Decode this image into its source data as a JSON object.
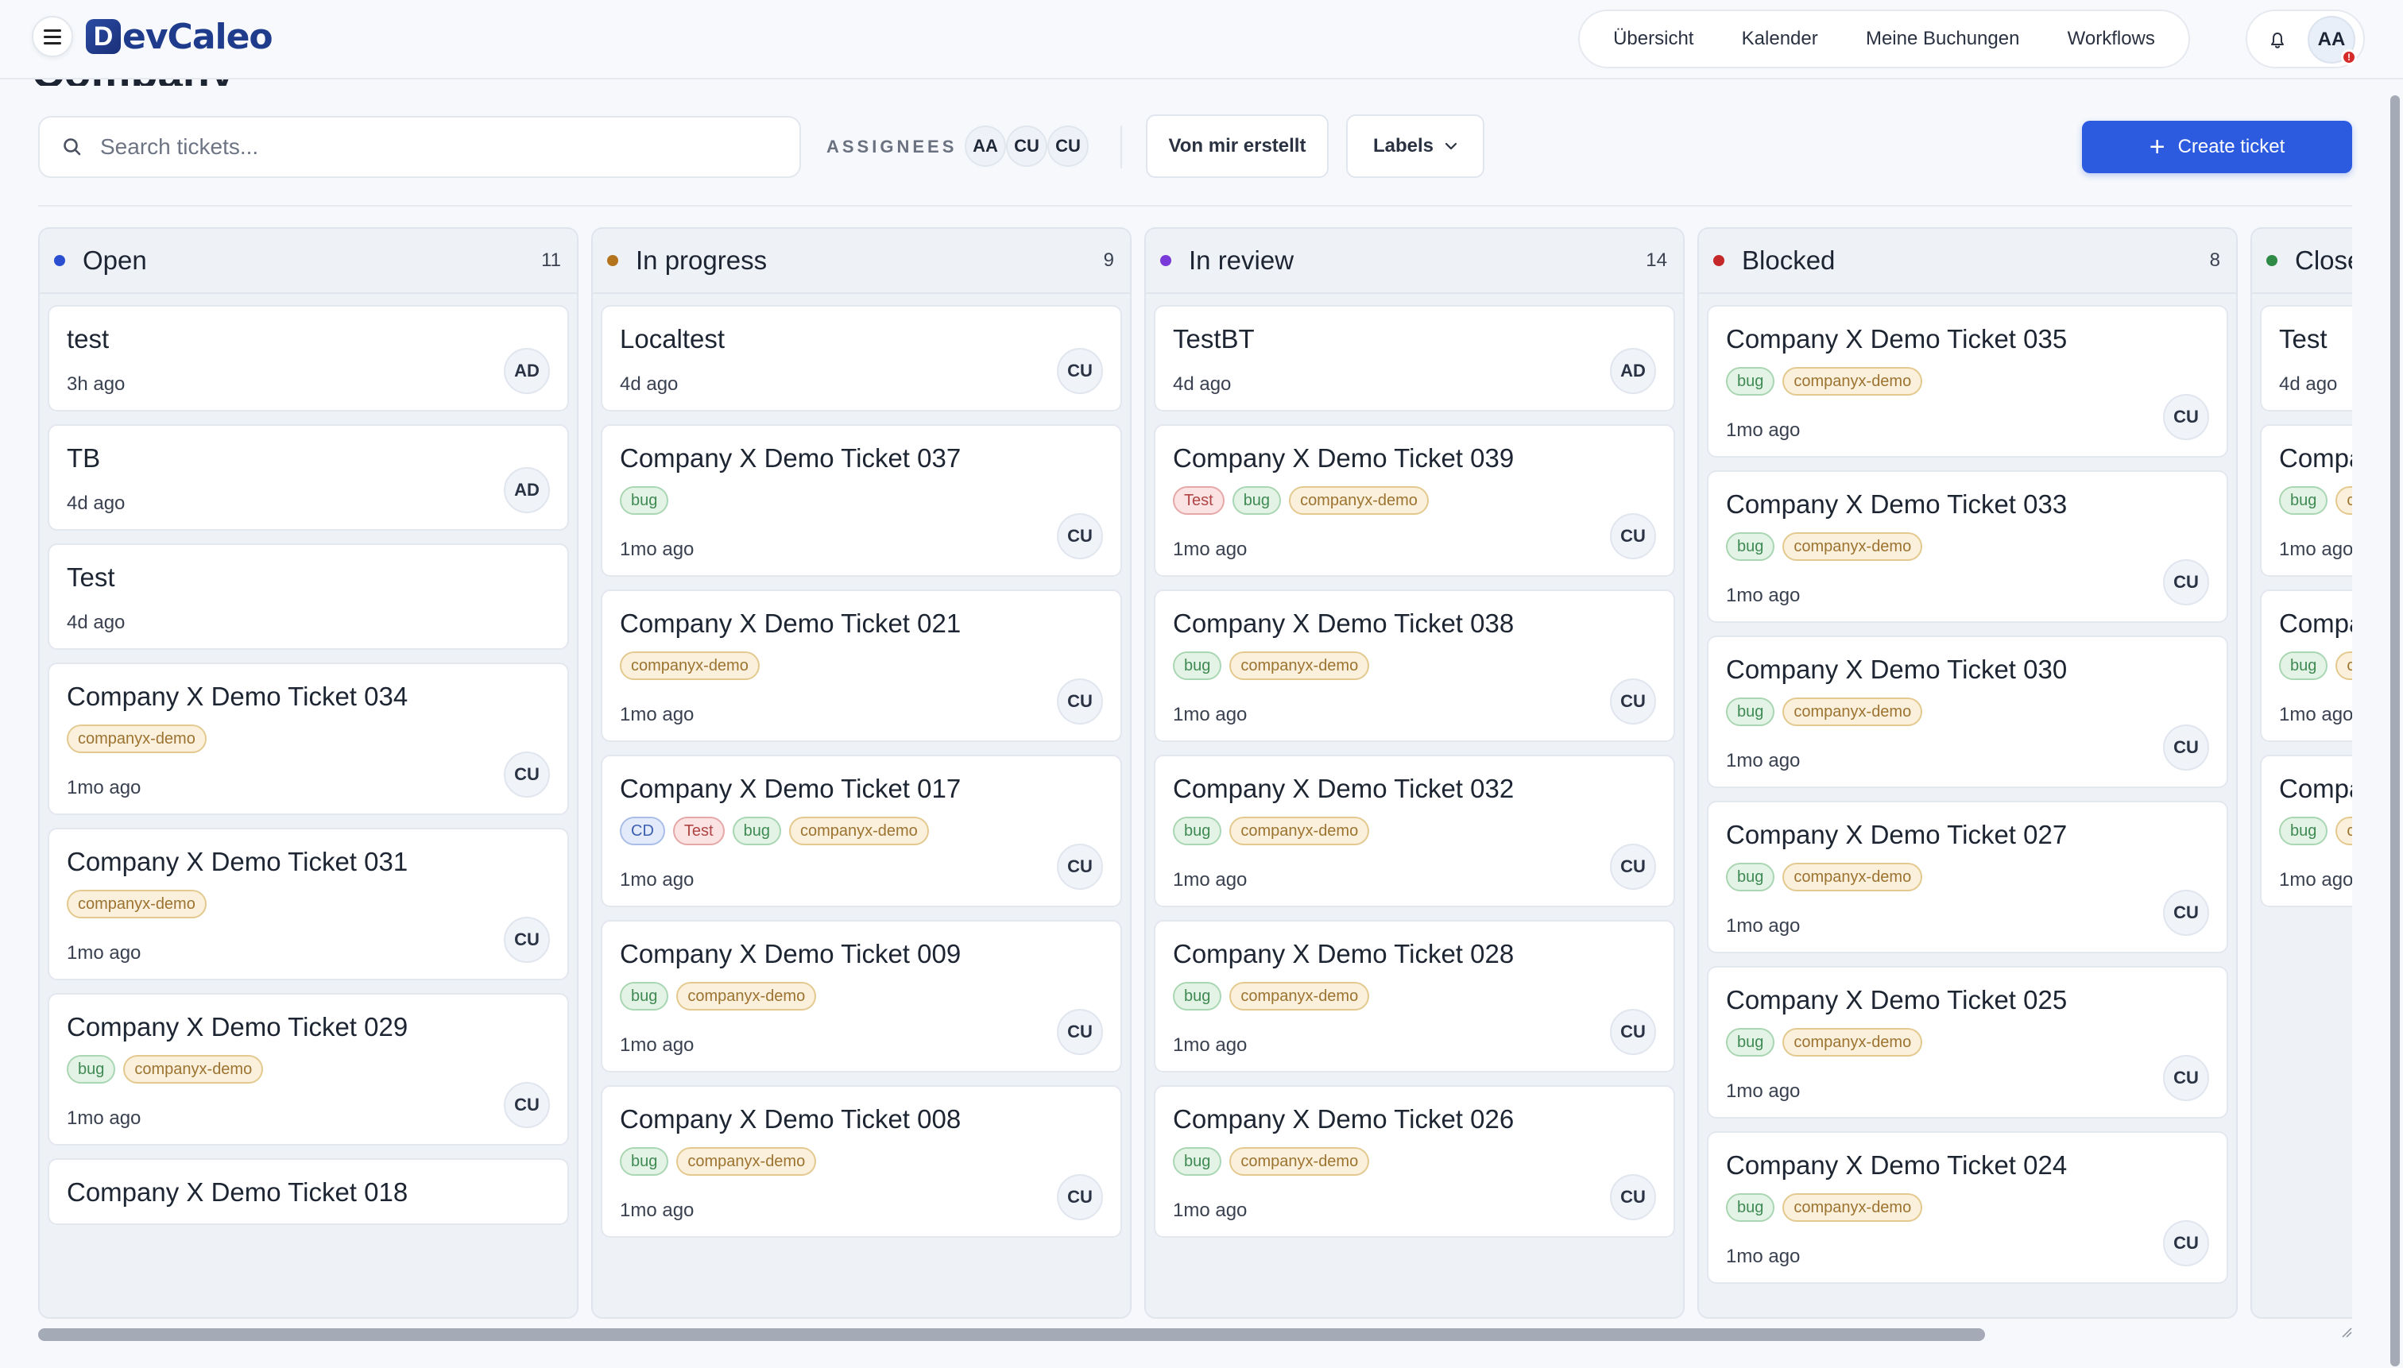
{
  "app": {
    "logo_mark": "D",
    "logo_text": "evCaleo",
    "page_title": "Company"
  },
  "nav": {
    "items": [
      "Übersicht",
      "Kalender",
      "Meine Buchungen",
      "Workflows"
    ]
  },
  "user": {
    "initials": "AA",
    "alert": "!"
  },
  "toolbar": {
    "search_placeholder": "Search tickets...",
    "assignees_label": "ASSIGNEES",
    "assignees": [
      "AA",
      "CU",
      "CU"
    ],
    "created_by_me": "Von mir erstellt",
    "labels": "Labels",
    "create": "Create ticket"
  },
  "colors": {
    "open": "#2b4ed1",
    "in_progress": "#b3741d",
    "in_review": "#7a3ad9",
    "blocked": "#c52828",
    "closed": "#2f8a45",
    "primary": "#2c5be0"
  },
  "board": {
    "columns": [
      {
        "title": "Open",
        "count": "11",
        "cards": [
          {
            "title": "test",
            "tags": [],
            "time": "3h ago",
            "assignee": "AD"
          },
          {
            "title": "TB",
            "tags": [],
            "time": "4d ago",
            "assignee": "AD"
          },
          {
            "title": "Test",
            "tags": [],
            "time": "4d ago",
            "assignee": ""
          },
          {
            "title": "Company X Demo Ticket 034",
            "tags": [
              "companyx-demo"
            ],
            "time": "1mo ago",
            "assignee": "CU"
          },
          {
            "title": "Company X Demo Ticket 031",
            "tags": [
              "companyx-demo"
            ],
            "time": "1mo ago",
            "assignee": "CU"
          },
          {
            "title": "Company X Demo Ticket 029",
            "tags": [
              "bug",
              "companyx-demo"
            ],
            "time": "1mo ago",
            "assignee": "CU"
          },
          {
            "title": "Company X Demo Ticket 018",
            "tags": [],
            "time": "",
            "assignee": ""
          }
        ]
      },
      {
        "title": "In progress",
        "count": "9",
        "cards": [
          {
            "title": "Localtest",
            "tags": [],
            "time": "4d ago",
            "assignee": "CU"
          },
          {
            "title": "Company X Demo Ticket 037",
            "tags": [
              "bug"
            ],
            "time": "1mo ago",
            "assignee": "CU"
          },
          {
            "title": "Company X Demo Ticket 021",
            "tags": [
              "companyx-demo"
            ],
            "time": "1mo ago",
            "assignee": "CU"
          },
          {
            "title": "Company X Demo Ticket 017",
            "tags": [
              "CD",
              "Test",
              "bug",
              "companyx-demo"
            ],
            "time": "1mo ago",
            "assignee": "CU"
          },
          {
            "title": "Company X Demo Ticket 009",
            "tags": [
              "bug",
              "companyx-demo"
            ],
            "time": "1mo ago",
            "assignee": "CU"
          },
          {
            "title": "Company X Demo Ticket 008",
            "tags": [
              "bug",
              "companyx-demo"
            ],
            "time": "1mo ago",
            "assignee": "CU"
          }
        ]
      },
      {
        "title": "In review",
        "count": "14",
        "cards": [
          {
            "title": "TestBT",
            "tags": [],
            "time": "4d ago",
            "assignee": "AD"
          },
          {
            "title": "Company X Demo Ticket 039",
            "tags": [
              "Test",
              "bug",
              "companyx-demo"
            ],
            "time": "1mo ago",
            "assignee": "CU"
          },
          {
            "title": "Company X Demo Ticket 038",
            "tags": [
              "bug",
              "companyx-demo"
            ],
            "time": "1mo ago",
            "assignee": "CU"
          },
          {
            "title": "Company X Demo Ticket 032",
            "tags": [
              "bug",
              "companyx-demo"
            ],
            "time": "1mo ago",
            "assignee": "CU"
          },
          {
            "title": "Company X Demo Ticket 028",
            "tags": [
              "bug",
              "companyx-demo"
            ],
            "time": "1mo ago",
            "assignee": "CU"
          },
          {
            "title": "Company X Demo Ticket 026",
            "tags": [
              "bug",
              "companyx-demo"
            ],
            "time": "1mo ago",
            "assignee": "CU"
          }
        ]
      },
      {
        "title": "Blocked",
        "count": "8",
        "cards": [
          {
            "title": "Company X Demo Ticket 035",
            "tags": [
              "bug",
              "companyx-demo"
            ],
            "time": "1mo ago",
            "assignee": "CU"
          },
          {
            "title": "Company X Demo Ticket 033",
            "tags": [
              "bug",
              "companyx-demo"
            ],
            "time": "1mo ago",
            "assignee": "CU"
          },
          {
            "title": "Company X Demo Ticket 030",
            "tags": [
              "bug",
              "companyx-demo"
            ],
            "time": "1mo ago",
            "assignee": "CU"
          },
          {
            "title": "Company X Demo Ticket 027",
            "tags": [
              "bug",
              "companyx-demo"
            ],
            "time": "1mo ago",
            "assignee": "CU"
          },
          {
            "title": "Company X Demo Ticket 025",
            "tags": [
              "bug",
              "companyx-demo"
            ],
            "time": "1mo ago",
            "assignee": "CU"
          },
          {
            "title": "Company X Demo Ticket 024",
            "tags": [
              "bug",
              "companyx-demo"
            ],
            "time": "1mo ago",
            "assignee": "CU"
          }
        ]
      },
      {
        "title": "Closed",
        "count": "",
        "cards": [
          {
            "title": "Test",
            "tags": [],
            "time": "4d ago",
            "assignee": ""
          },
          {
            "title": "Company X Demo Ticket",
            "tags": [
              "bug",
              "companyx-demo"
            ],
            "time": "1mo ago",
            "assignee": ""
          },
          {
            "title": "Company X Demo Ticket",
            "tags": [
              "bug",
              "companyx-demo"
            ],
            "time": "1mo ago",
            "assignee": ""
          },
          {
            "title": "Company X Demo Ticket",
            "tags": [
              "bug",
              "companyx-demo"
            ],
            "time": "1mo ago",
            "assignee": ""
          }
        ]
      }
    ]
  }
}
